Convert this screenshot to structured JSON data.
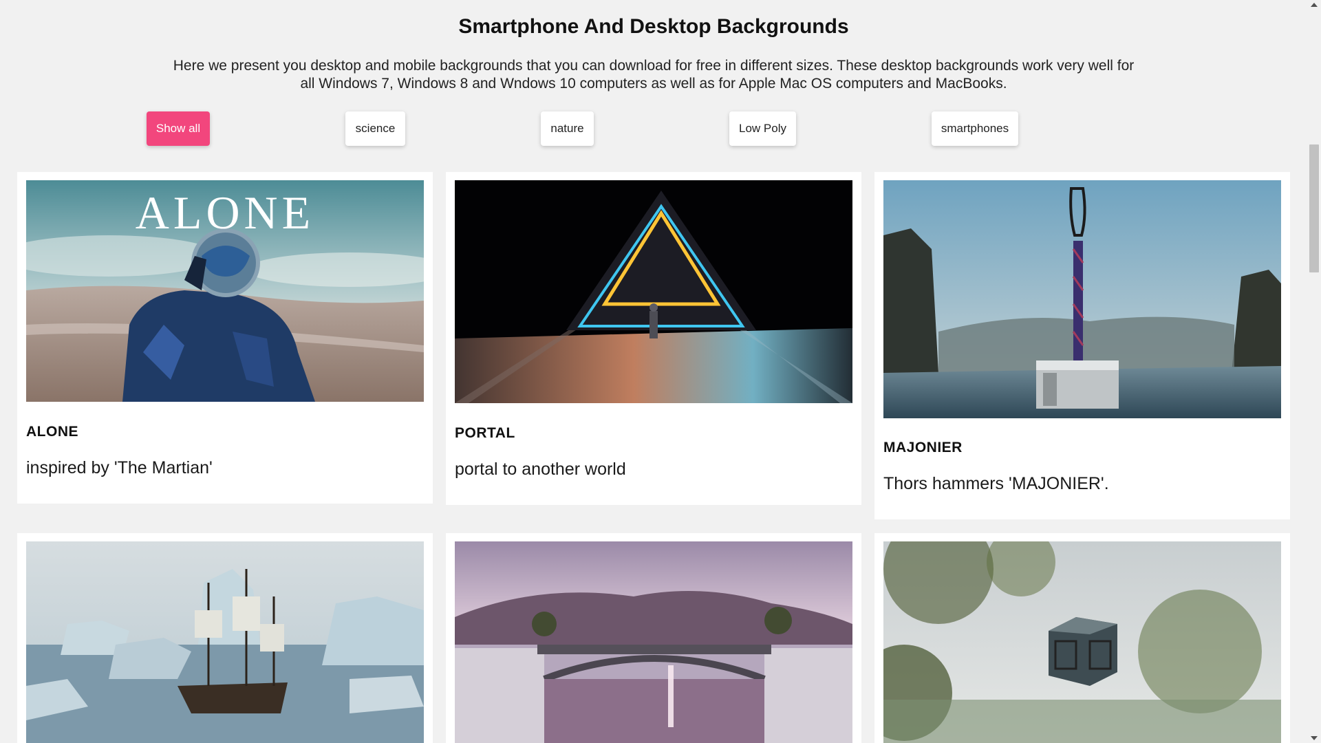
{
  "page": {
    "title": "Smartphone And Desktop Backgrounds",
    "intro": "Here we present you desktop and mobile backgrounds that you can download for free in different sizes. These desktop backgrounds work very well for all Windows 7, Windows 8 and Wndows 10 computers as well as for Apple Mac OS computers and MacBooks."
  },
  "filters": [
    {
      "label": "Show all",
      "active": true
    },
    {
      "label": "science",
      "active": false
    },
    {
      "label": "nature",
      "active": false
    },
    {
      "label": "Low Poly",
      "active": false
    },
    {
      "label": "smartphones",
      "active": false
    }
  ],
  "cards": [
    {
      "name": "ALONE",
      "description": "inspired by 'The Martian'",
      "image_text": "ALONE"
    },
    {
      "name": "PORTAL",
      "description": "portal to another world"
    },
    {
      "name": "MAJONIER",
      "description": "Thors hammers 'MAJONIER'."
    },
    {
      "name": "",
      "description": ""
    },
    {
      "name": "",
      "description": ""
    },
    {
      "name": "",
      "description": ""
    }
  ],
  "colors": {
    "accent": "#f2467d",
    "background": "#f1f1f1"
  }
}
